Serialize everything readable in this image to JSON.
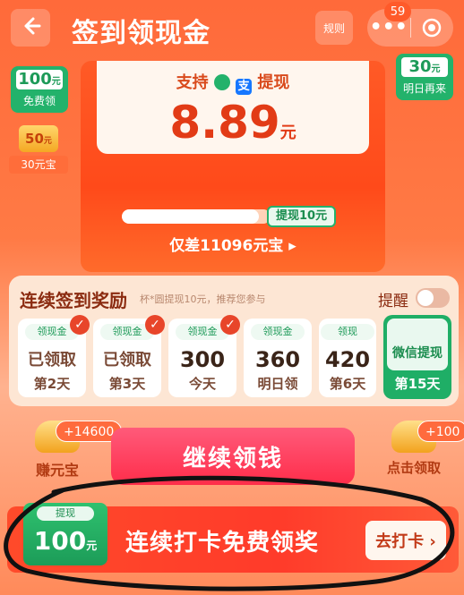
{
  "header": {
    "title": "签到领现金",
    "rules_label": "规则",
    "notification_count": "59"
  },
  "left_cards": {
    "card_100": {
      "amount": "100",
      "unit": "元",
      "label": "免费领"
    },
    "card_50": {
      "amount": "50",
      "unit": "元",
      "label": "30元宝"
    }
  },
  "right_card": {
    "amount": "30",
    "unit": "元",
    "label": "明日再来"
  },
  "envelope": {
    "support_prefix": "支持",
    "support_icon_wechat": "wechat-pay-icon",
    "support_icon_alipay_glyph": "支",
    "support_suffix": "提现",
    "amount": "8.89",
    "amount_unit": "元",
    "progress_fraction": 0.92,
    "target_label": "提现10元",
    "gap_text": "仅差11096元宝 ▸"
  },
  "signin_panel": {
    "title": "连续签到奖励",
    "subtitle": "杯*圆提现10元，推荐您参与",
    "remind_label": "提醒",
    "remind_on": false,
    "days": [
      {
        "tag": "领现金",
        "value": "已领取",
        "day": "第2天",
        "checked": true
      },
      {
        "tag": "领现金",
        "value": "已领取",
        "day": "第3天",
        "checked": true
      },
      {
        "tag": "领现金",
        "value": "300",
        "day": "今天",
        "checked": true
      },
      {
        "tag": "领现金",
        "value": "360",
        "day": "明日领",
        "checked": false
      },
      {
        "tag": "领现",
        "value": "420",
        "day": "第6天",
        "checked": false
      }
    ],
    "final_day": {
      "reward": "微信提现",
      "day": "第15天"
    }
  },
  "actions": {
    "earn_label": "赚元宝",
    "earn_bubble": "+14600",
    "main_button": "继续领钱",
    "claim_label": "点击领取",
    "claim_bubble": "+100"
  },
  "banner": {
    "ticket_tag": "提现",
    "ticket_amount": "100",
    "ticket_unit": "元",
    "text": "连续打卡免费领奖",
    "button": "去打卡 ›"
  }
}
